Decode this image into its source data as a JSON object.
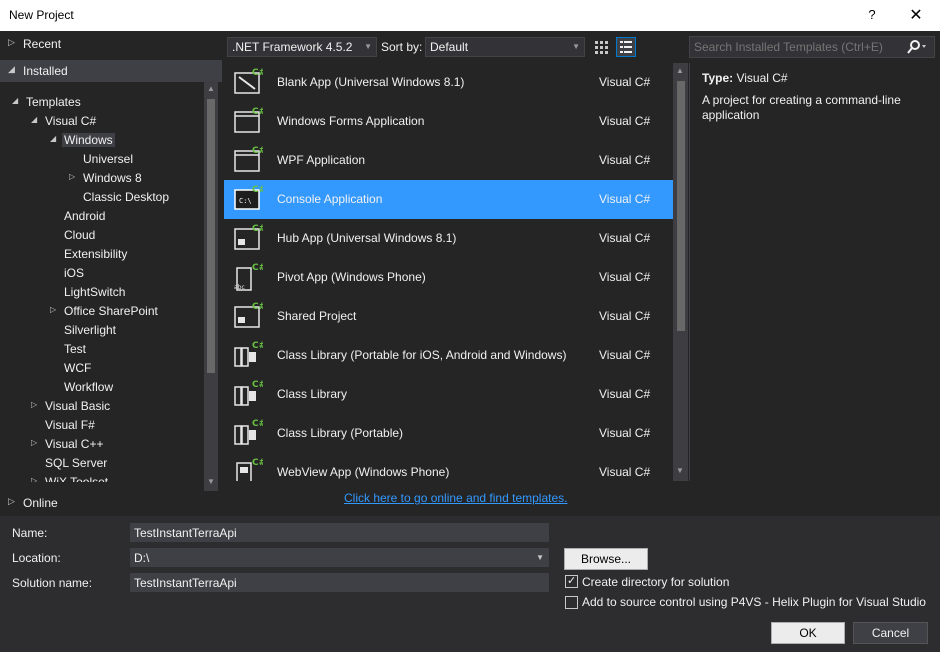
{
  "window": {
    "title": "New Project",
    "help": "?",
    "close": "✕"
  },
  "left": {
    "recent": "Recent",
    "installed": "Installed",
    "online": "Online",
    "tree": [
      {
        "label": "Templates",
        "arrow": "◢"
      },
      {
        "label": "Visual C#",
        "arrow": "◢"
      },
      {
        "label": "Windows",
        "arrow": "◢"
      },
      {
        "label": "Universel",
        "arrow": ""
      },
      {
        "label": "Windows 8",
        "arrow": "▷"
      },
      {
        "label": "Classic Desktop",
        "arrow": ""
      },
      {
        "label": "Android",
        "arrow": ""
      },
      {
        "label": "Cloud",
        "arrow": ""
      },
      {
        "label": "Extensibility",
        "arrow": ""
      },
      {
        "label": "iOS",
        "arrow": ""
      },
      {
        "label": "LightSwitch",
        "arrow": ""
      },
      {
        "label": "Office SharePoint",
        "arrow": "▷"
      },
      {
        "label": "Silverlight",
        "arrow": ""
      },
      {
        "label": "Test",
        "arrow": ""
      },
      {
        "label": "WCF",
        "arrow": ""
      },
      {
        "label": "Workflow",
        "arrow": ""
      },
      {
        "label": "Visual Basic",
        "arrow": "▷"
      },
      {
        "label": "Visual F#",
        "arrow": ""
      },
      {
        "label": "Visual C++",
        "arrow": "▷"
      },
      {
        "label": "SQL Server",
        "arrow": ""
      },
      {
        "label": "WiX Toolset",
        "arrow": "▷"
      }
    ]
  },
  "toolbar": {
    "framework": ".NET Framework 4.5.2",
    "sort_label": "Sort by:",
    "sort_value": "Default",
    "search_placeholder": "Search Installed Templates (Ctrl+E)"
  },
  "templates": [
    {
      "name": "Blank App (Universal Windows 8.1)",
      "lang": "Visual C#",
      "icon": "universal-app-icon"
    },
    {
      "name": "Windows Forms Application",
      "lang": "Visual C#",
      "icon": "windows-forms-icon"
    },
    {
      "name": "WPF Application",
      "lang": "Visual C#",
      "icon": "wpf-icon"
    },
    {
      "name": "Console Application",
      "lang": "Visual C#",
      "icon": "console-icon",
      "selected": true
    },
    {
      "name": "Hub App (Universal Windows 8.1)",
      "lang": "Visual C#",
      "icon": "hub-app-icon"
    },
    {
      "name": "Pivot App (Windows Phone)",
      "lang": "Visual C#",
      "icon": "pivot-app-icon"
    },
    {
      "name": "Shared Project",
      "lang": "Visual C#",
      "icon": "shared-project-icon"
    },
    {
      "name": "Class Library (Portable for iOS, Android and Windows)",
      "lang": "Visual C#",
      "icon": "class-library-icon"
    },
    {
      "name": "Class Library",
      "lang": "Visual C#",
      "icon": "class-library-icon"
    },
    {
      "name": "Class Library (Portable)",
      "lang": "Visual C#",
      "icon": "class-library-icon"
    },
    {
      "name": "WebView App (Windows Phone)",
      "lang": "Visual C#",
      "icon": "webview-app-icon"
    }
  ],
  "online_link": "Click here to go online and find templates.",
  "description": {
    "type_label": "Type:",
    "type_value": "Visual C#",
    "text": "A project for creating a command-line application"
  },
  "form": {
    "name_label": "Name:",
    "name_value": "TestInstantTerraApi",
    "location_label": "Location:",
    "location_value": "D:\\",
    "solution_label": "Solution name:",
    "solution_value": "TestInstantTerraApi",
    "browse": "Browse...",
    "create_dir": "Create directory for solution",
    "create_dir_checked": true,
    "source_control": "Add to source control using P4VS - Helix Plugin for Visual Studio",
    "source_control_checked": false,
    "ok": "OK",
    "cancel": "Cancel"
  },
  "colors": {
    "accent": "#3399ff",
    "background": "#252526",
    "panel": "#2d2d30",
    "csharp_badge": "#68c142"
  }
}
